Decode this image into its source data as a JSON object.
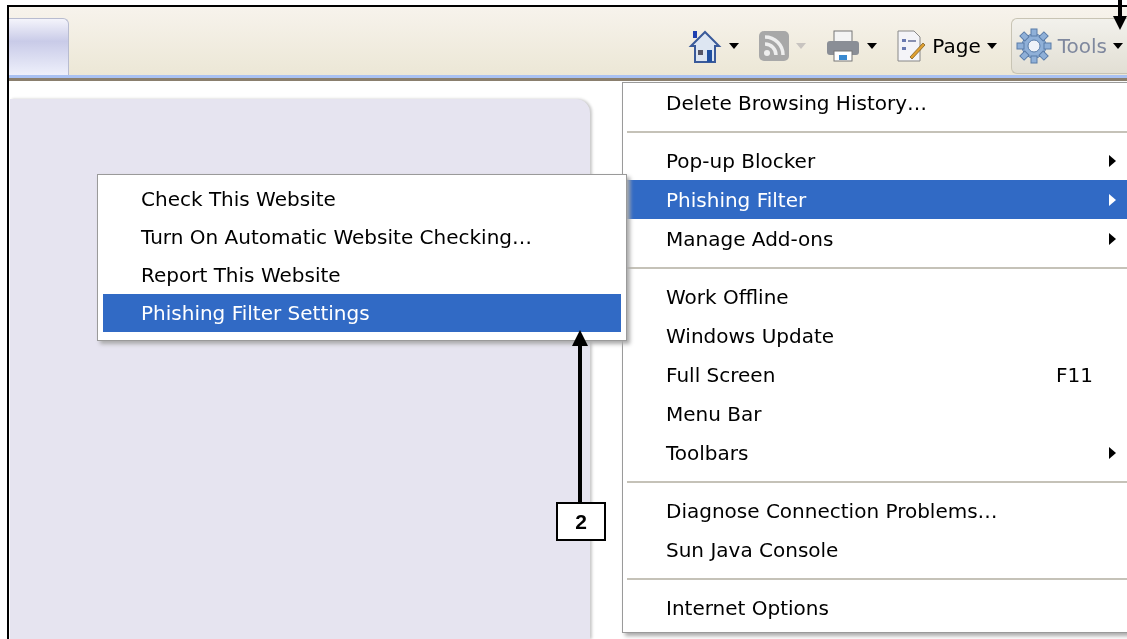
{
  "toolbar": {
    "buttons": [
      {
        "kind": "home",
        "disabled": false,
        "selected": false
      },
      {
        "kind": "feed",
        "disabled": true,
        "selected": false
      },
      {
        "kind": "print",
        "disabled": false,
        "selected": false
      },
      {
        "kind": "page",
        "label": "Page",
        "disabled": false,
        "selected": false
      },
      {
        "kind": "tools",
        "label": "Tools",
        "disabled": false,
        "selected": true
      }
    ]
  },
  "tools_menu": {
    "groups": [
      [
        {
          "label": "Delete Browsing History…",
          "submenu": false,
          "selected": false
        }
      ],
      [
        {
          "label": "Pop-up Blocker",
          "submenu": true,
          "selected": false
        },
        {
          "label": "Phishing Filter",
          "submenu": true,
          "selected": true
        },
        {
          "label": "Manage Add-ons",
          "submenu": true,
          "selected": false
        }
      ],
      [
        {
          "label": "Work Offline",
          "submenu": false,
          "selected": false
        },
        {
          "label": "Windows Update",
          "submenu": false,
          "selected": false
        },
        {
          "label": "Full Screen",
          "shortcut": "F11",
          "submenu": false,
          "selected": false
        },
        {
          "label": "Menu Bar",
          "submenu": false,
          "selected": false
        },
        {
          "label": "Toolbars",
          "submenu": true,
          "selected": false
        }
      ],
      [
        {
          "label": "Diagnose Connection Problems…",
          "submenu": false,
          "selected": false
        },
        {
          "label": "Sun Java Console",
          "submenu": false,
          "selected": false
        }
      ],
      [
        {
          "label": "Internet Options",
          "submenu": false,
          "selected": false
        }
      ]
    ]
  },
  "phishing_submenu": {
    "items": [
      {
        "label": "Check This Website",
        "selected": false
      },
      {
        "label": "Turn On Automatic Website Checking…",
        "selected": false
      },
      {
        "label": "Report This Website",
        "selected": false
      },
      {
        "label": "Phishing Filter Settings",
        "selected": true
      }
    ]
  },
  "callout": {
    "label": "2"
  }
}
